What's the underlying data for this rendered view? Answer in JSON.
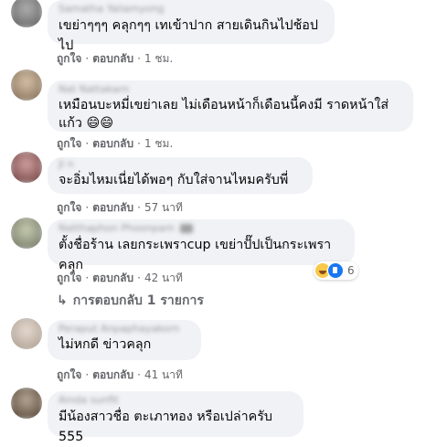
{
  "comments": [
    {
      "name": "Samatha Yaliamyong",
      "text": "เขย่าๆๆๆ คลุกๆๆ เทเข้าปาก สายเดินกินไปช้อปไป",
      "like": "ถูกใจ",
      "reply": "ตอบกลับ",
      "time": "1 ชม.",
      "avatar_color": "#8a8a8a"
    },
    {
      "name": "Nat Nattakarn",
      "text": "เหมือนบะหมี่เขย่าเลย ไม่เดือนหน้าก็เดือนนี้คงมี ราดหน้าใส่\nแก้ว 😄😄",
      "like": "ถูกใจ",
      "reply": "ตอบกลับ",
      "time": "1 ชม.",
      "avatar_color": "#b49a7a"
    },
    {
      "name": "Ji n",
      "text": "จะอิ่มไหมเนี่ยได้พอๆ กับใส่จานไหมครับพี่",
      "like": "ถูกใจ",
      "reply": "ตอบกลับ",
      "time": "57 นาที",
      "avatar_color": "#a06a6a"
    },
    {
      "name": "Natthaphon Phoonpam",
      "text": "ตั้งชื่อร้าน เลยกระเพราcup เขย่าปั๊ปเป็นกระเพราคลุก",
      "like": "ถูกใจ",
      "reply": "ตอบกลับ",
      "time": "42 นาที",
      "avatar_color": "#9aa08a"
    },
    {
      "name": "Peraput Anpaphayakorn",
      "text": "ไม่หกดี ข่าวคลุก",
      "like": "ถูกใจ",
      "reply": "ตอบกลับ",
      "time": "41 นาที",
      "avatar_color": "#c9b8a8"
    },
    {
      "name": "Ainda sunfit",
      "text": "มีน้องสาวชื่อ ตะเภาทอง หรือเปล่าครับ 555",
      "avatar_color": "#7a6a5a"
    }
  ],
  "reactions": {
    "count": "6",
    "icons": [
      "haha-icon",
      "like-icon"
    ]
  },
  "replies_label": "การตอบกลับ 1 รายการ",
  "colors": {
    "bubble": "#f0f2f5",
    "meta": "#65676b",
    "like_blue": "#1877f2"
  }
}
